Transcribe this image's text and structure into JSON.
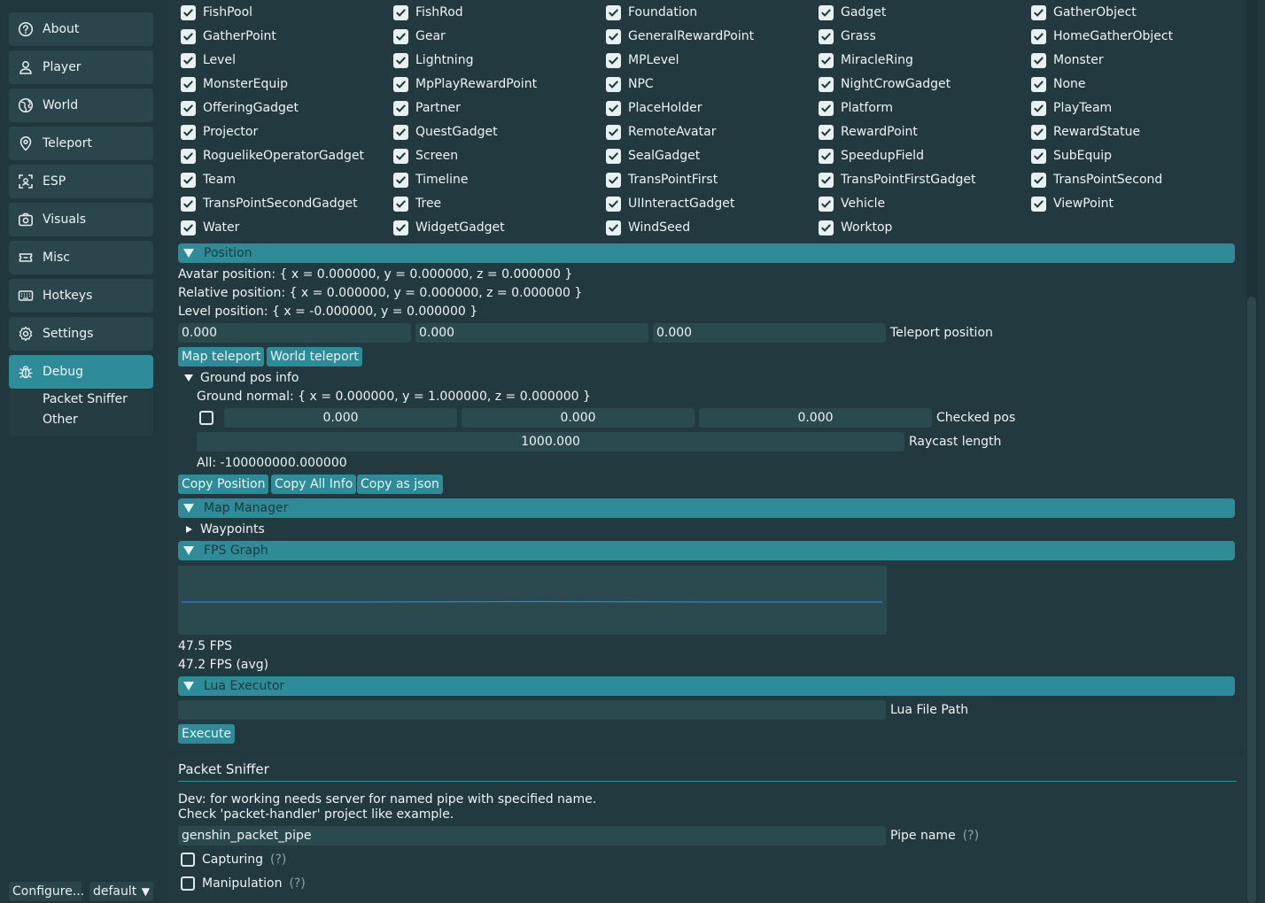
{
  "sidebar": {
    "items": [
      {
        "label": "About",
        "icon": "question-circle-icon"
      },
      {
        "label": "Player",
        "icon": "user-icon"
      },
      {
        "label": "World",
        "icon": "globe-icon"
      },
      {
        "label": "Teleport",
        "icon": "map-pin-icon"
      },
      {
        "label": "ESP",
        "icon": "scan-face-icon"
      },
      {
        "label": "Visuals",
        "icon": "camera-icon"
      },
      {
        "label": "Misc",
        "icon": "ticket-icon"
      },
      {
        "label": "Hotkeys",
        "icon": "keyboard-icon"
      },
      {
        "label": "Settings",
        "icon": "gear-icon"
      },
      {
        "label": "Debug",
        "icon": "bug-icon",
        "active": true
      }
    ],
    "subitems": [
      "Packet Sniffer",
      "Other"
    ],
    "configure_label": "Configure...",
    "profile_label": "default",
    "profile_arrow": "▼"
  },
  "entity_filters": {
    "partial_row": [
      "FishPool",
      "FishRod",
      "Foundation",
      "Gadget",
      "GatherObject"
    ],
    "rows": [
      [
        "GatherPoint",
        "Gear",
        "GeneralRewardPoint",
        "Grass",
        "HomeGatherObject"
      ],
      [
        "Level",
        "Lightning",
        "MPLevel",
        "MiracleRing",
        "Monster"
      ],
      [
        "MonsterEquip",
        "MpPlayRewardPoint",
        "NPC",
        "NightCrowGadget",
        "None"
      ],
      [
        "OfferingGadget",
        "Partner",
        "PlaceHolder",
        "Platform",
        "PlayTeam"
      ],
      [
        "Projector",
        "QuestGadget",
        "RemoteAvatar",
        "RewardPoint",
        "RewardStatue"
      ],
      [
        "RoguelikeOperatorGadget",
        "Screen",
        "SealGadget",
        "SpeedupField",
        "SubEquip"
      ],
      [
        "Team",
        "Timeline",
        "TransPointFirst",
        "TransPointFirstGadget",
        "TransPointSecond"
      ],
      [
        "TransPointSecondGadget",
        "Tree",
        "UIInteractGadget",
        "Vehicle",
        "ViewPoint"
      ],
      [
        "Water",
        "WidgetGadget",
        "WindSeed",
        "Worktop"
      ]
    ]
  },
  "position": {
    "header": "Position",
    "avatar": "Avatar position: { x = 0.000000, y = 0.000000, z = 0.000000 }",
    "relative": "Relative position: { x = 0.000000, y = 0.000000, z = 0.000000 }",
    "level": "Level position: { x = -0.000000, y = 0.000000 }",
    "tp_x": "0.000",
    "tp_y": "0.000",
    "tp_z": "0.000",
    "tp_label": "Teleport position",
    "map_teleport": "Map teleport",
    "world_teleport": "World teleport",
    "ground_header": "Ground pos info",
    "ground_normal": "Ground normal: { x = 0.000000, y = 1.000000, z = 0.000000 }",
    "checked_x": "0.000",
    "checked_y": "0.000",
    "checked_z": "0.000",
    "checked_label": "Checked pos",
    "raycast_value": "1000.000",
    "raycast_label": "Raycast length",
    "all": "All: -100000000.000000",
    "copy_position": "Copy Position",
    "copy_all": "Copy All Info",
    "copy_json": "Copy as json"
  },
  "map_manager": {
    "header": "Map Manager",
    "waypoints": "Waypoints"
  },
  "fps": {
    "header": "FPS Graph",
    "current": "47.5 FPS",
    "avg": "47.2 FPS (avg)",
    "line_color": "#2f7fd6"
  },
  "lua": {
    "header": "Lua Executor",
    "path_value": "",
    "path_label": "Lua File Path",
    "execute": "Execute"
  },
  "packet_sniffer": {
    "title": "Packet Sniffer",
    "desc1": "Dev: for working needs server for named pipe with specified name.",
    "desc2": "Check 'packet-handler' project like example.",
    "pipe_value": "genshin_packet_pipe",
    "pipe_label": "Pipe name",
    "help": "(?)",
    "capturing": "Capturing",
    "manipulation": "Manipulation"
  },
  "colors": {
    "accent": "#2d8c97",
    "background": "#1f373d",
    "panel": "#21393f",
    "field": "#2a4a50"
  }
}
